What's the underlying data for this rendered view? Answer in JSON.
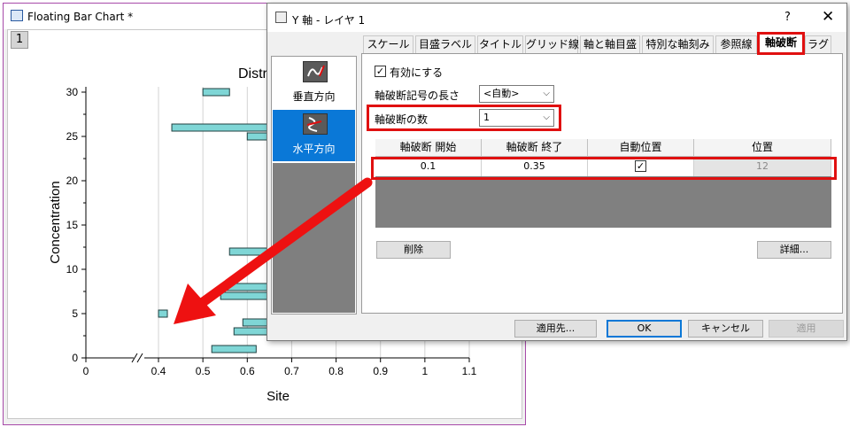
{
  "graph_window": {
    "title": "Floating Bar Chart *",
    "layer_number": "1",
    "chart_title_visible": "Distr"
  },
  "chart_data": {
    "type": "bar",
    "orientation": "floating-horizontal",
    "xlabel": "Site",
    "ylabel": "Concentration",
    "x_ticks": [
      "0",
      "0.4",
      "0.5",
      "0.6",
      "0.7",
      "0.8",
      "0.9",
      "1",
      "1.1"
    ],
    "y_ticks": [
      "0",
      "5",
      "10",
      "15",
      "20",
      "25",
      "30"
    ],
    "axis_break": {
      "from": 0.1,
      "to": 0.35
    },
    "xlim": [
      0,
      1.1
    ],
    "ylim": [
      0,
      30
    ],
    "bars": [
      {
        "y": 30,
        "x_start": 0.5,
        "x_end": 0.56
      },
      {
        "y": 26,
        "x_start": 0.43,
        "x_end": 0.72
      },
      {
        "y": 25,
        "x_start": 0.6,
        "x_end": 0.68
      },
      {
        "y": 12,
        "x_start": 0.56,
        "x_end": 0.66
      },
      {
        "y": 8,
        "x_start": 0.55,
        "x_end": 0.68
      },
      {
        "y": 7,
        "x_start": 0.54,
        "x_end": 0.68
      },
      {
        "y": 5,
        "x_start": 0.4,
        "x_end": 0.42
      },
      {
        "y": 4,
        "x_start": 0.59,
        "x_end": 0.68
      },
      {
        "y": 3,
        "x_start": 0.57,
        "x_end": 0.66
      },
      {
        "y": 1,
        "x_start": 0.52,
        "x_end": 0.62
      }
    ],
    "bar_color": "#7fd6d6",
    "grid": "vertical"
  },
  "dialog": {
    "title": "Y 軸 - レイヤ 1",
    "help": "?",
    "close": "✕",
    "tabs": [
      "スケール",
      "目盛ラベル",
      "タイトル",
      "グリッド線",
      "軸と軸目盛",
      "特別な軸刻み",
      "参照線",
      "軸破断",
      "ラグ"
    ],
    "active_tab": "軸破断",
    "side_items": [
      {
        "label": "垂直方向",
        "selected": false
      },
      {
        "label": "水平方向",
        "selected": true
      }
    ],
    "enable_label": "有効にする",
    "enable_checked": true,
    "symbol_length_label": "軸破断記号の長さ",
    "symbol_length_value": "<自動>",
    "break_count_label": "軸破断の数",
    "break_count_value": "1",
    "grid_headers": [
      "軸破断 開始",
      "軸破断 終了",
      "自動位置",
      "位置"
    ],
    "grid_row": {
      "start": "0.1",
      "end": "0.35",
      "auto": true,
      "position": "12"
    },
    "delete_button": "削除",
    "details_button": "詳細...",
    "apply_to_button": "適用先...",
    "ok_button": "OK",
    "cancel_button": "キャンセル",
    "apply_button": "適用"
  },
  "colors": {
    "highlight": "#e01010",
    "selection": "#0a78d7",
    "window_border": "#a74aa9"
  }
}
